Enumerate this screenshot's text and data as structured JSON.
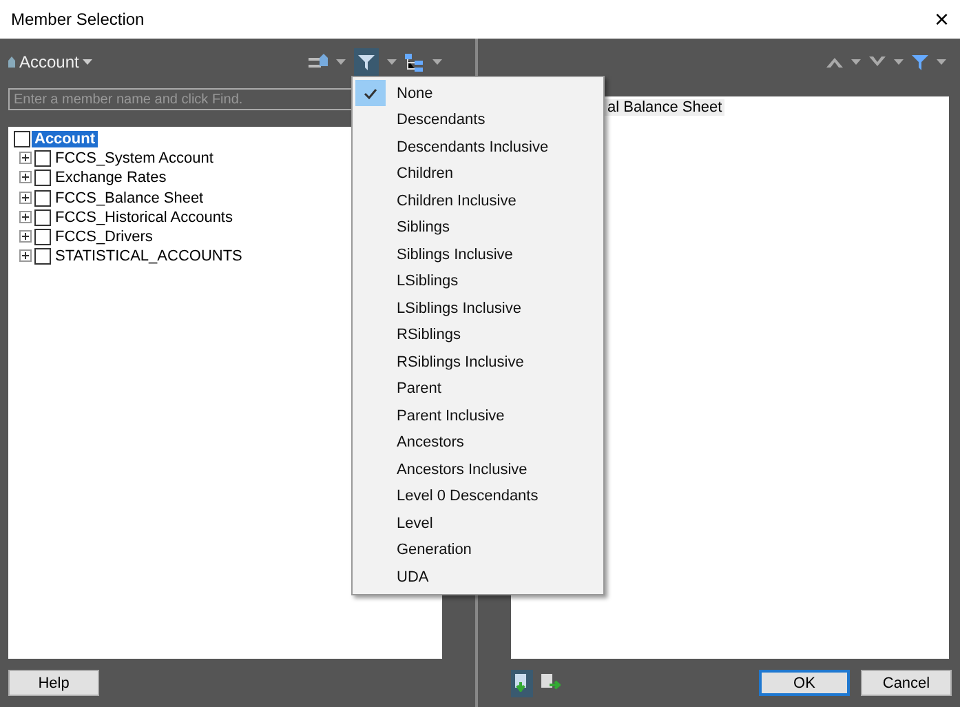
{
  "window": {
    "title": "Member Selection",
    "close": "×"
  },
  "left": {
    "dimension": "Account",
    "search": {
      "placeholder": "Enter a member name and click Find."
    },
    "tree": {
      "label": "Account",
      "checked": false,
      "selected": true,
      "children": [
        {
          "label": "FCCS_System Account",
          "checked": false,
          "selected": false,
          "expanded": false
        },
        {
          "label": "Exchange Rates",
          "checked": false,
          "selected": false,
          "expanded": false
        },
        {
          "label": "FCCS_Balance Sheet",
          "checked": false,
          "selected": false,
          "expanded": false
        },
        {
          "label": "FCCS_Historical Accounts",
          "checked": false,
          "selected": false,
          "expanded": false
        },
        {
          "label": "FCCS_Drivers",
          "checked": false,
          "selected": false,
          "expanded": false
        },
        {
          "label": "STATISTICAL_ACCOUNTS",
          "checked": false,
          "selected": false,
          "expanded": false
        }
      ]
    }
  },
  "filter_menu": [
    {
      "label": "None",
      "selected": true
    },
    {
      "label": "Descendants",
      "selected": false
    },
    {
      "label": "Descendants Inclusive",
      "selected": false
    },
    {
      "label": "Children",
      "selected": false
    },
    {
      "label": "Children Inclusive",
      "selected": false
    },
    {
      "label": "Siblings",
      "selected": false
    },
    {
      "label": "Siblings Inclusive",
      "selected": false
    },
    {
      "label": "LSiblings",
      "selected": false
    },
    {
      "label": "LSiblings Inclusive",
      "selected": false
    },
    {
      "label": "RSiblings",
      "selected": false
    },
    {
      "label": "RSiblings Inclusive",
      "selected": false
    },
    {
      "label": "Parent",
      "selected": false
    },
    {
      "label": "Parent Inclusive",
      "selected": false
    },
    {
      "label": "Ancestors",
      "selected": false
    },
    {
      "label": "Ancestors Inclusive",
      "selected": false
    },
    {
      "label": "Level 0 Descendants",
      "selected": false
    },
    {
      "label": "Level",
      "selected": false
    },
    {
      "label": "Generation",
      "selected": false
    },
    {
      "label": "UDA",
      "selected": false
    }
  ],
  "right": {
    "selections": [
      "al Balance Sheet"
    ]
  },
  "buttons": {
    "help": "Help",
    "ok": "OK",
    "cancel": "Cancel"
  }
}
